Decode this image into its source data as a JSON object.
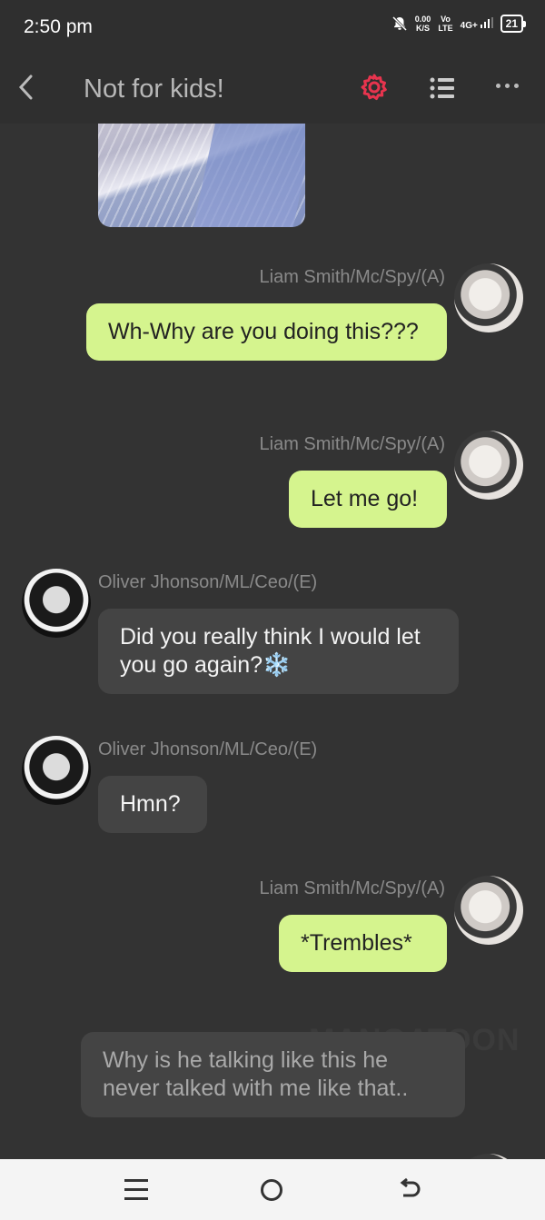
{
  "status_bar": {
    "time": "2:50 pm",
    "net_speed_value": "0.00",
    "net_speed_unit": "K/S",
    "volte_top": "Vo",
    "volte_bottom": "LTE",
    "network": "4G+",
    "battery": "21"
  },
  "header": {
    "title": "Not for kids!",
    "settings_icon": "gear-icon",
    "list_icon": "list-icon",
    "more_icon": "more-dots-icon",
    "accent_color": "#e8344e"
  },
  "messages": [
    {
      "sender": "Liam Smith/Mc/Spy/(A)",
      "text": "Wh-Why are you doing this???",
      "side": "right"
    },
    {
      "sender": "Liam Smith/Mc/Spy/(A)",
      "text": "Let me go!",
      "side": "right"
    },
    {
      "sender": "Oliver Jhonson/ML/Ceo/(E)",
      "text": "Did you really think I would let you go again?❄️",
      "side": "left"
    },
    {
      "sender": "Oliver Jhonson/ML/Ceo/(E)",
      "text": "Hmn?",
      "side": "left"
    },
    {
      "sender": "Liam Smith/Mc/Spy/(A)",
      "text": "*Trembles*",
      "side": "right"
    },
    {
      "sender": "",
      "text": "Why is he talking like this he never talked with me like that..",
      "side": "narration"
    }
  ],
  "colors": {
    "my_bubble": "#d5f48e",
    "their_bubble": "#444444",
    "background": "#333333"
  },
  "watermark": "MANGATOON"
}
